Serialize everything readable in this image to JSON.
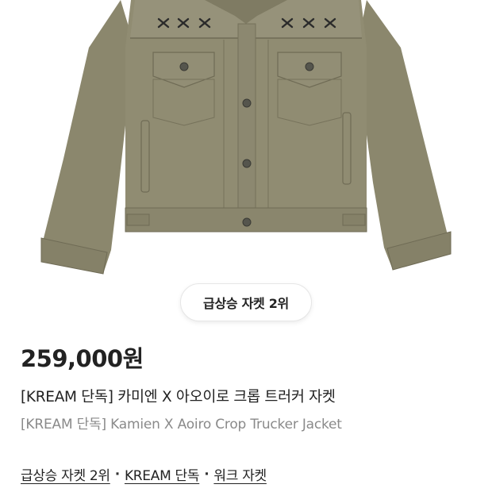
{
  "product_image": {
    "alt": "Kamien X Aoiro Crop Trucker Jacket",
    "jacket_color": "#8d8a70",
    "stitch_color": "#2b2b2b"
  },
  "rank_chip": {
    "label": "급상승 자켓 2위"
  },
  "price": "259,000원",
  "title_ko": "[KREAM 단독] 카미엔 X 아오이로 크롭 트러커 자켓",
  "title_en": "[KREAM 단독] Kamien X Aoiro Crop Trucker Jacket",
  "tags": [
    {
      "label": "급상승 자켓 2위"
    },
    {
      "label": "KREAM 단독"
    },
    {
      "label": "워크 자켓"
    }
  ],
  "tag_separator": "·"
}
